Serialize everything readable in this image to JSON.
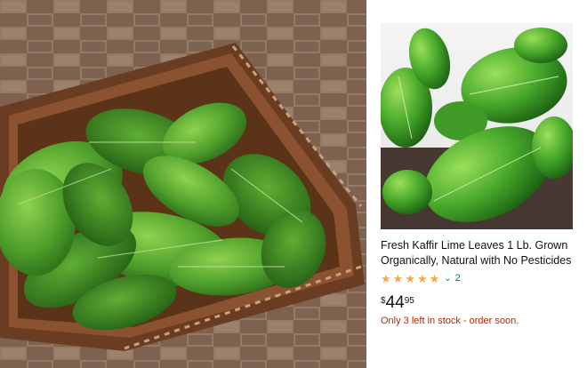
{
  "product": {
    "title": "Fresh Kaffir Lime Leaves 1 Lb. Grown Organically, Natural with No Pesticides",
    "rating_value": 5,
    "rating_count": "2",
    "price_symbol": "$",
    "price_whole": "44",
    "price_fraction": "95",
    "stock_message": "Only 3 left in stock - order soon.",
    "star_icon": "star-icon",
    "chevron_icon": "chevron-down-icon"
  },
  "colors": {
    "star": "#f3a847",
    "link": "#007185",
    "stock": "#b12704",
    "leaf_light": "#6fb83f",
    "leaf_dark": "#2f7d1f",
    "basket": "#7a4a2a"
  }
}
